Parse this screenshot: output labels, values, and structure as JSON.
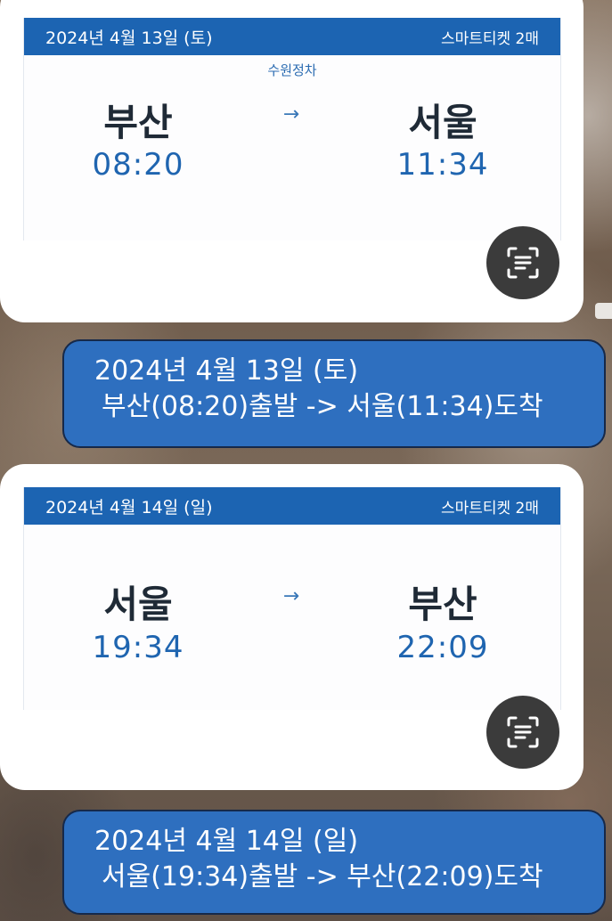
{
  "tickets": [
    {
      "date": "2024년 4월 13일 (토)",
      "ticket_type": "스마트티켓 2매",
      "via": "수원정차",
      "from_city": "부산",
      "from_time": "08:20",
      "to_city": "서울",
      "to_time": "11:34",
      "arrow": "→"
    },
    {
      "date": "2024년 4월 14일 (일)",
      "ticket_type": "스마트티켓 2매",
      "via": "",
      "from_city": "서울",
      "from_time": "19:34",
      "to_city": "부산",
      "to_time": "22:09",
      "arrow": "→"
    }
  ],
  "messages": [
    {
      "line1": "2024년 4월 13일 (토)",
      "line2": "부산(08:20)출발 -> 서울(11:34)도착"
    },
    {
      "line1": "2024년 4월 14일 (일)",
      "line2": "서울(19:34)출발 -> 부산(22:09)도착"
    }
  ],
  "icons": {
    "scan": "text-scan-icon",
    "direction": "arrow-right-icon"
  },
  "colors": {
    "header_blue": "#1c64b2",
    "time_blue": "#1f65b0",
    "bubble_blue": "#2e6fbf",
    "scan_button": "#3b3b3b"
  }
}
